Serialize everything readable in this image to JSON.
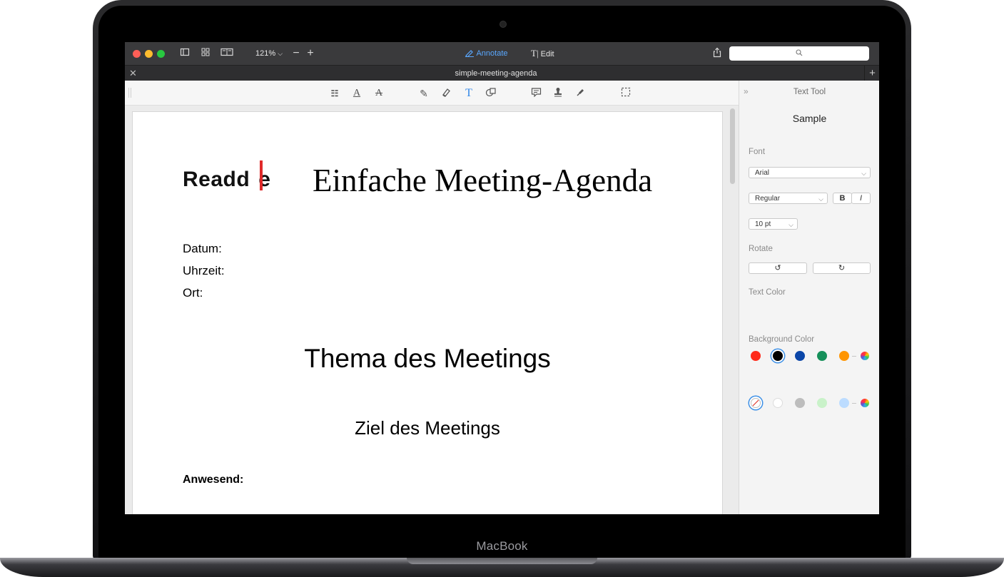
{
  "device": {
    "brand": "MacBook"
  },
  "window": {
    "zoom_level": "121%",
    "modes": {
      "annotate": "Annotate",
      "edit": "Edit"
    },
    "tab": {
      "title": "simple-meeting-agenda"
    }
  },
  "document": {
    "logo": "Readd",
    "logo_tail": "e",
    "title": "Einfache Meeting-Agenda",
    "fields": [
      "Datum:",
      "Uhrzeit:",
      "Ort:"
    ],
    "topic_heading": "Thema des Meetings",
    "goal_heading": "Ziel des Meetings",
    "attendees_label": "Anwesend:"
  },
  "panel": {
    "title": "Text Tool",
    "sample": "Sample",
    "font_label": "Font",
    "font_family": "Arial",
    "font_style": "Regular",
    "bold_label": "B",
    "italic_label": "I",
    "font_size": "10 pt",
    "rotate_label": "Rotate",
    "text_color_label": "Text Color",
    "background_color_label": "Background Color",
    "text_colors": [
      "#ff2a1a",
      "#000000",
      "#0b46a8",
      "#16905a",
      "#ff9500"
    ],
    "background_colors": [
      "none",
      "#ffffff",
      "#bdbdbd",
      "#c9f2c9",
      "#bcdcff"
    ]
  },
  "colors": {
    "accent": "#3b8fe6",
    "logo_red": "#e02a2a"
  },
  "icons": {
    "sidebar": "sidebar-icon",
    "grid": "grid-icon",
    "two_page": "two-page-icon",
    "zoom_out": "minus-icon",
    "zoom_in": "plus-icon",
    "share": "share-icon",
    "search": "search-icon"
  }
}
